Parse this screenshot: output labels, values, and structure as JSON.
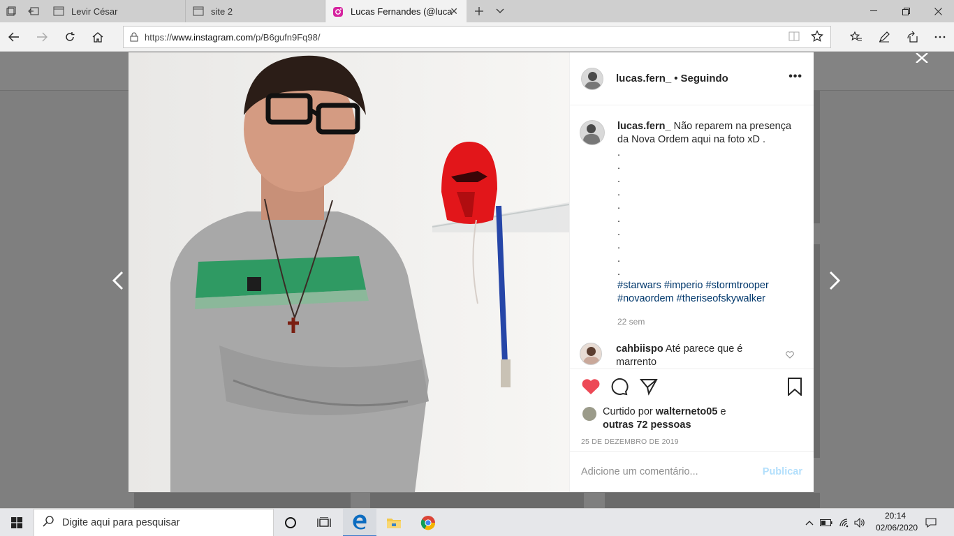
{
  "browser": {
    "tabs": [
      {
        "label": "Levir César"
      },
      {
        "label": "site 2"
      },
      {
        "label": "Lucas Fernandes (@luca"
      }
    ],
    "url_prefix": "https://",
    "url_host": "www.instagram.com",
    "url_path": "/p/B6gufn9Fq98/"
  },
  "post": {
    "username": "lucas.fern_",
    "follow_status": "Seguindo",
    "caption_text": "Não reparem na presença da Nova Ordem aqui na foto xD .",
    "caption_dots": [
      ".",
      ".",
      ".",
      ".",
      ".",
      ".",
      ".",
      ".",
      ".",
      "."
    ],
    "hashtags": [
      "#starwars",
      "#imperio",
      "#stormtrooper",
      "#novaordem",
      "#theriseofskywalker"
    ],
    "time_ago": "22 sem",
    "comment": {
      "username": "cahbiispo",
      "text": "Até parece que é marrento"
    },
    "likes_prefix": "Curtido por",
    "likes_user": "walterneto05",
    "likes_and": "e",
    "likes_others": "outras 72 pessoas",
    "date": "25 DE DEZEMBRO DE 2019",
    "comment_placeholder": "Adicione um comentário...",
    "publish_label": "Publicar"
  },
  "taskbar": {
    "search_placeholder": "Digite aqui para pesquisar",
    "time": "20:14",
    "date": "02/06/2020"
  },
  "colors": {
    "like_red": "#ed4956",
    "link_blue": "#00376b",
    "publish_disabled": "#b2dffc"
  }
}
